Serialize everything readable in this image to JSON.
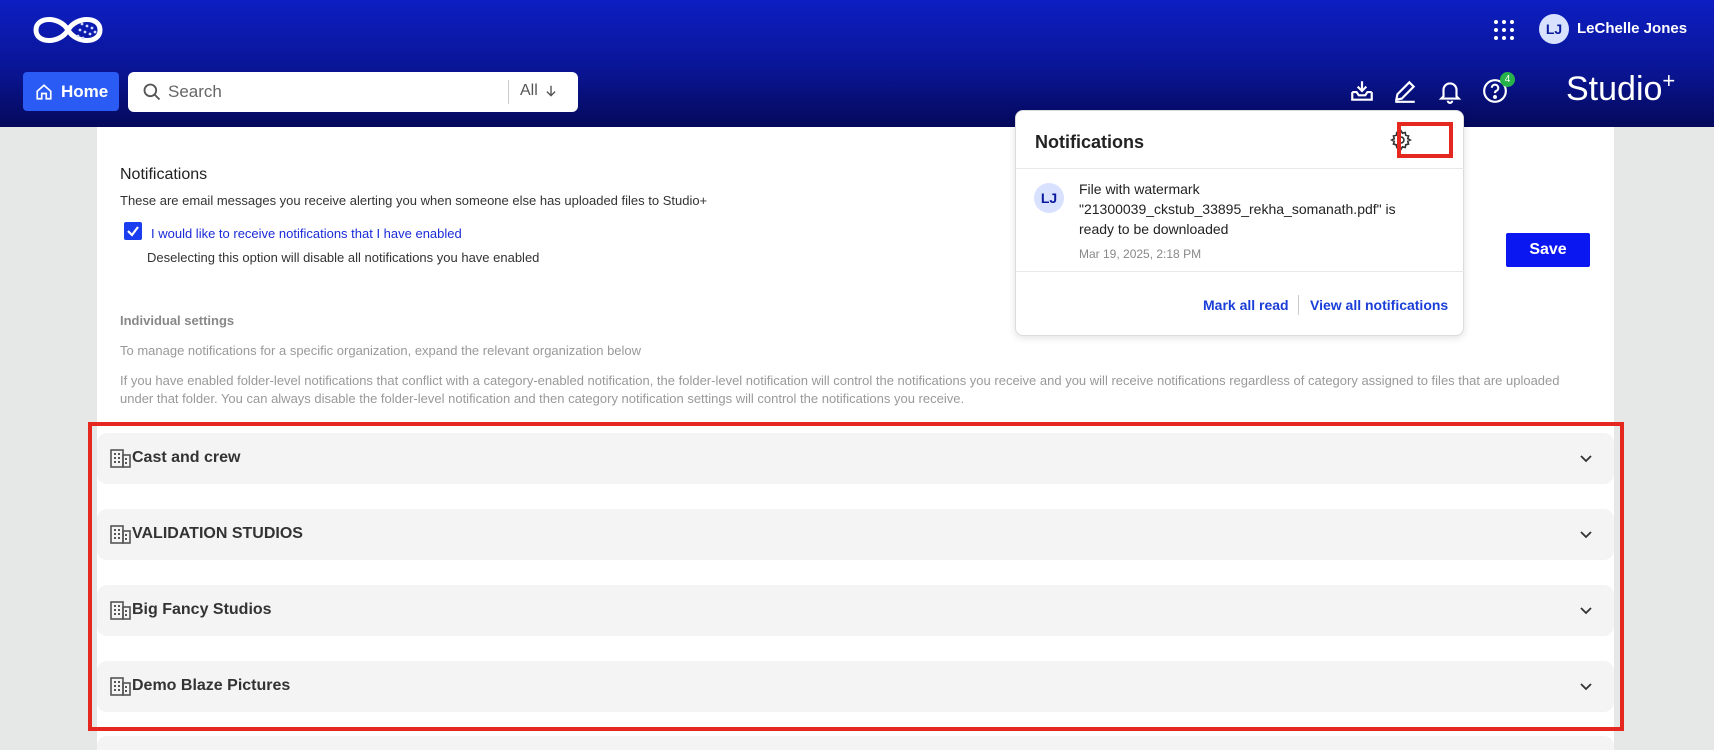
{
  "header": {
    "user_initials": "LJ",
    "user_name": "LeChelle Jones",
    "home_label": "Home",
    "search_placeholder": "Search",
    "search_scope": "All",
    "help_badge_count": "4",
    "brand_text": "Studio",
    "brand_sup": "+"
  },
  "settings": {
    "title": "Notifications",
    "description": "These are email messages you receive alerting you when someone else has uploaded files to Studio+",
    "checkbox_label": "I would like to receive notifications that I have enabled",
    "checkbox_checked": true,
    "checkbox_subtext": "Deselecting this option will disable all notifications you have enabled",
    "save_label": "Save",
    "individual_title": "Individual settings",
    "individual_desc1": "To manage notifications for a specific organization, expand the relevant organization below",
    "individual_desc2": "If you have enabled folder-level notifications that conflict with a category-enabled notification, the folder-level notification will control the notifications you receive and you will receive notifications regardless of category assigned to files that are uploaded under that folder. You can always disable the folder-level notification and then category notification settings will control the notifications you receive."
  },
  "organizations": [
    {
      "name": "Cast and crew"
    },
    {
      "name": "VALIDATION STUDIOS"
    },
    {
      "name": "Big Fancy Studios"
    },
    {
      "name": "Demo Blaze Pictures"
    }
  ],
  "notifications_panel": {
    "title": "Notifications",
    "item": {
      "avatar": "LJ",
      "message": "File with watermark \"21300039_ckstub_33895_rekha_somanath.pdf\" is ready to be downloaded",
      "time": "Mar 19, 2025, 2:18 PM"
    },
    "mark_all_read": "Mark all read",
    "view_all": "View all notifications"
  },
  "colors": {
    "header_top": "#0d1ec2",
    "header_bottom": "#04095a",
    "accent": "#0b17f0",
    "highlight": "#e5281f"
  }
}
